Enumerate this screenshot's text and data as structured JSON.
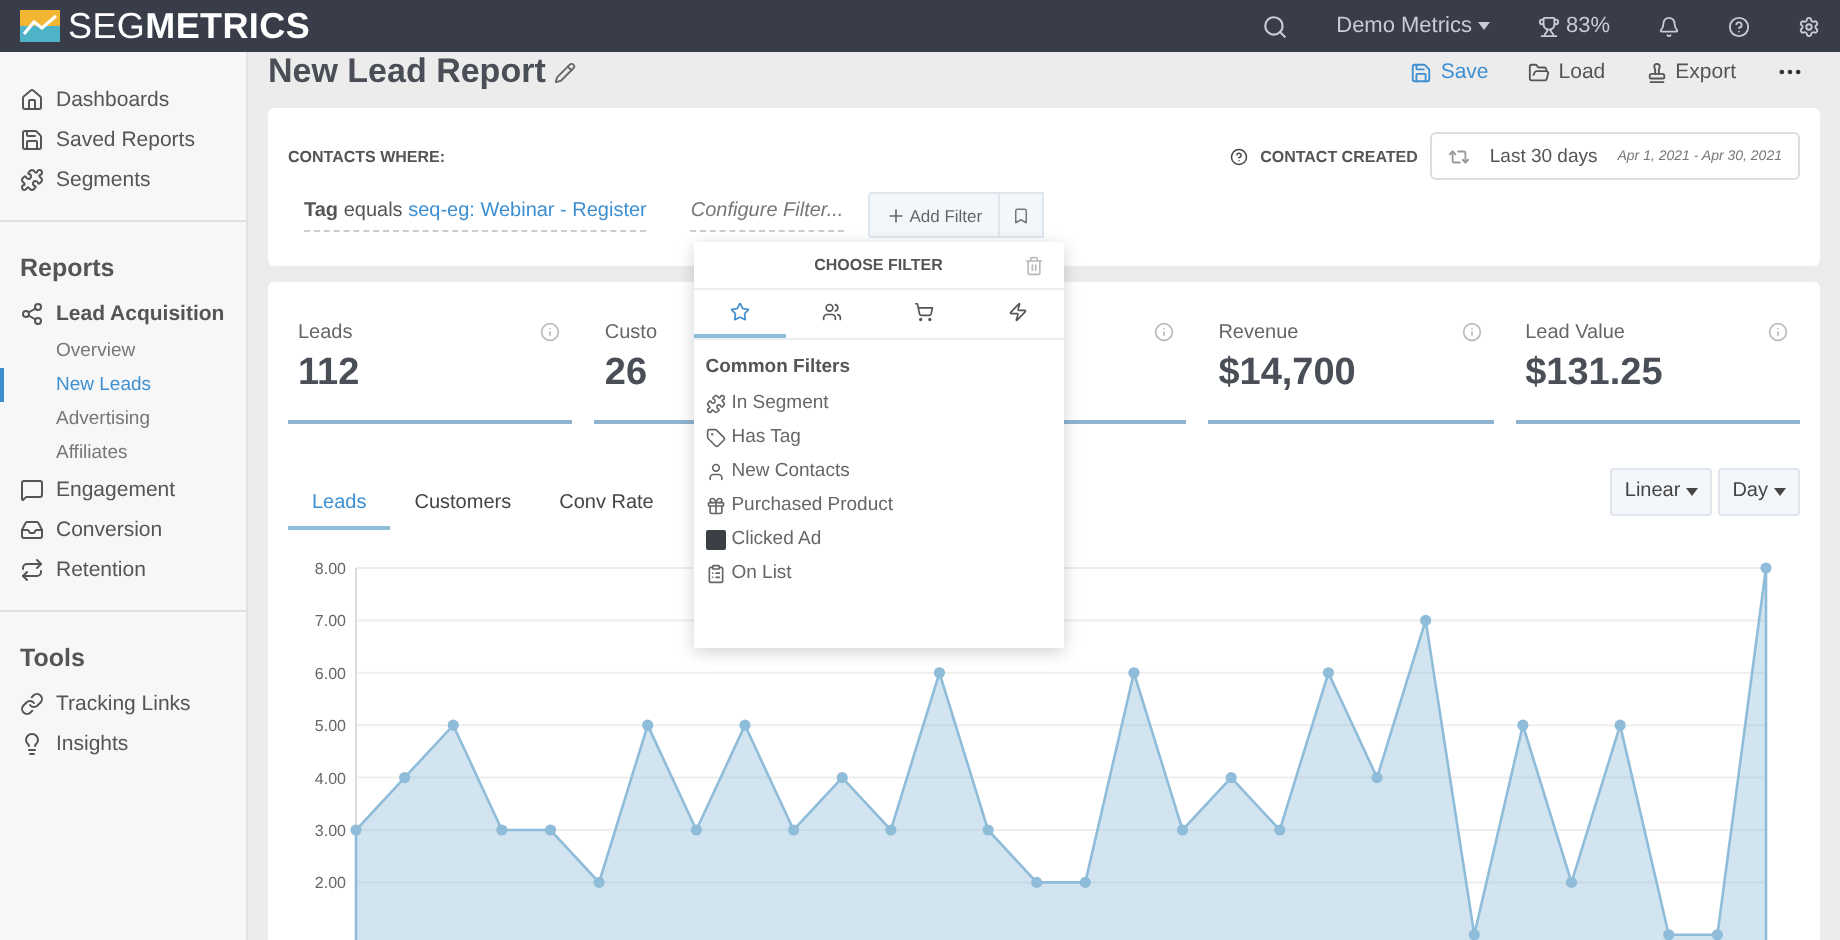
{
  "topbar": {
    "brand": "SEG**METRICS**",
    "account": "Demo Metrics",
    "score": "83%"
  },
  "sidebar": [
    {
      "items": [
        {
          "label": "Dashboards",
          "selected": false,
          "expanded": false
        },
        {
          "label": "Saved Reports",
          "selected": false,
          "expanded": false
        },
        {
          "label": "Segments",
          "selected": false,
          "expanded": false
        }
      ]
    },
    {
      "title": "Reports",
      "items": [
        {
          "label": "Lead Acquisition",
          "selected": false,
          "expanded": true,
          "children": [
            {
              "label": "Overview",
              "selected": false
            },
            {
              "label": "New Leads",
              "selected": true
            },
            {
              "label": "Advertising",
              "selected": false
            },
            {
              "label": "Affiliates",
              "selected": false
            }
          ]
        },
        {
          "label": "Engagement",
          "selected": false,
          "expanded": false
        },
        {
          "label": "Conversion",
          "selected": false,
          "expanded": false
        },
        {
          "label": "Retention",
          "selected": false,
          "expanded": false
        }
      ]
    },
    {
      "title": "Tools",
      "items": [
        {
          "label": "Tracking Links",
          "selected": false,
          "expanded": false
        },
        {
          "label": "Insights",
          "selected": false,
          "expanded": false
        }
      ]
    }
  ],
  "header": {
    "title": "New Lead Report",
    "actions": [
      {
        "label": "Save",
        "primary": true
      },
      {
        "label": "Load",
        "primary": false
      },
      {
        "label": "Export",
        "primary": false
      }
    ]
  },
  "filters": {
    "heading": "CONTACTS WHERE:",
    "condition": "**Tag** equals",
    "condition_value": "seq-eg: Webinar - Register",
    "configure_placeholder": "Configure Filter...",
    "add_button": "Add Filter",
    "date_field": "CONTACT CREATED",
    "date_range": "Last 30 days",
    "date_span": "Apr 1, 2021 - Apr 30, 2021"
  },
  "filter_menu": {
    "title": "CHOOSE FILTER",
    "tabs": [
      {
        "selected": true
      },
      {
        "selected": false
      },
      {
        "selected": false
      },
      {
        "selected": false
      }
    ],
    "section": "Common Filters",
    "items": [
      "In Segment",
      "Has Tag",
      "New Contacts",
      "Purchased Product",
      "Clicked Ad",
      "On List"
    ]
  },
  "metrics": [
    {
      "label": "Leads",
      "value": "112",
      "info": true
    },
    {
      "label": "Custo",
      "value": "26"
    },
    {
      "info": true
    },
    {
      "label": "Revenue",
      "value": "$14,700",
      "info": true
    },
    {
      "label": "Lead Value",
      "value": "$131.25",
      "info": true
    }
  ],
  "chart_tabs": [
    {
      "label": "Leads",
      "selected": true
    },
    {
      "label": "Customers",
      "selected": false
    },
    {
      "label": "Conv Rate",
      "selected": false
    }
  ],
  "chart_controls": [
    "Linear",
    "Day"
  ],
  "chart": {
    "chart_data": {
      "type": "area",
      "grid": true,
      "ylim": [
        0,
        8
      ],
      "yticks": [
        {
          "value": 2,
          "label": "2.00"
        },
        {
          "value": 3,
          "label": "3.00"
        },
        {
          "value": 4,
          "label": "4.00"
        },
        {
          "value": 5,
          "label": "5.00"
        },
        {
          "value": 6,
          "label": "6.00"
        },
        {
          "value": 7,
          "label": "7.00"
        },
        {
          "value": 8,
          "label": "8.00"
        }
      ],
      "series": [
        {
          "color": "#8fbcd9",
          "values": [
            3,
            4,
            5,
            3,
            3,
            2,
            5,
            3,
            5,
            3,
            4,
            3,
            6,
            3,
            2,
            2,
            6,
            3,
            4,
            3,
            6,
            4,
            7,
            1,
            5,
            2,
            5,
            1,
            1,
            8
          ]
        }
      ]
    }
  }
}
